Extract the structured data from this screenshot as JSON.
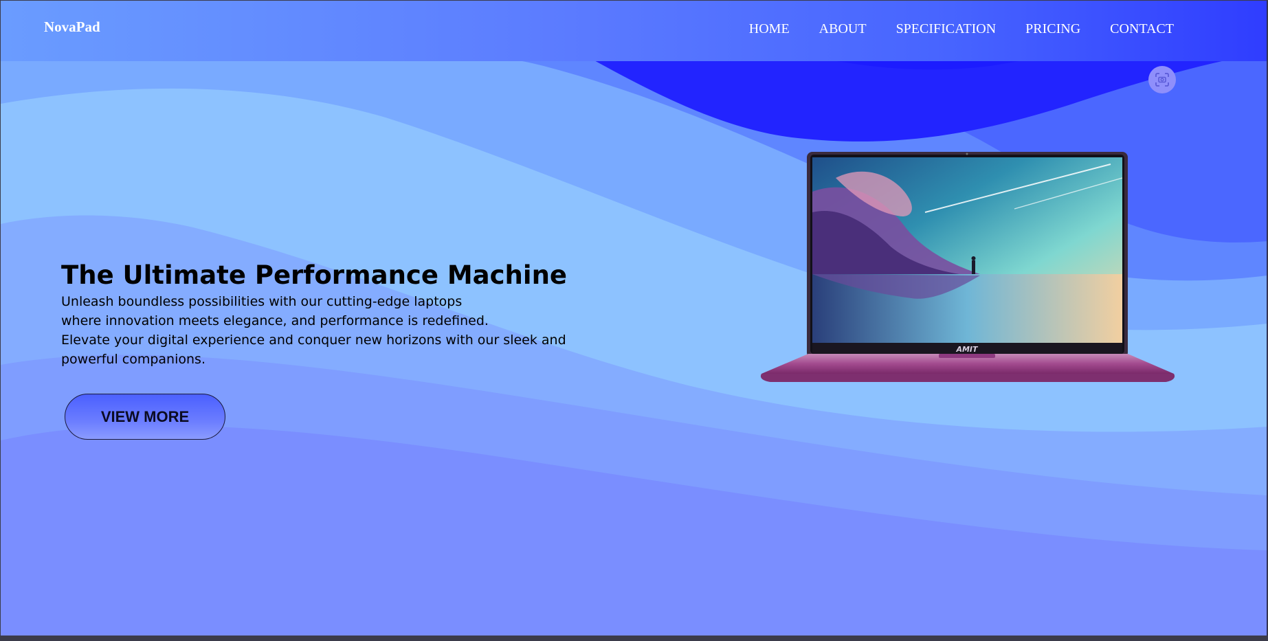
{
  "brand": "NovaPad",
  "nav": {
    "items": [
      "HOME",
      "ABOUT",
      "SPECIFICATION",
      "PRICING",
      "CONTACT"
    ]
  },
  "hero": {
    "title": "The Ultimate Performance Machine",
    "lines": [
      "Unleash boundless possibilities with our cutting-edge laptops",
      "where innovation meets elegance, and performance is redefined.",
      "Elevate your digital experience and conquer new horizons with our sleek and powerful companions."
    ],
    "button": "VIEW MORE"
  },
  "laptop": {
    "keyboard_brand": "AMIT"
  },
  "icons": {
    "screenshot": "screen-capture-icon"
  },
  "colors": {
    "accent": "#4b60ff",
    "navbar_end": "#2f3dff",
    "text": "#000000"
  }
}
